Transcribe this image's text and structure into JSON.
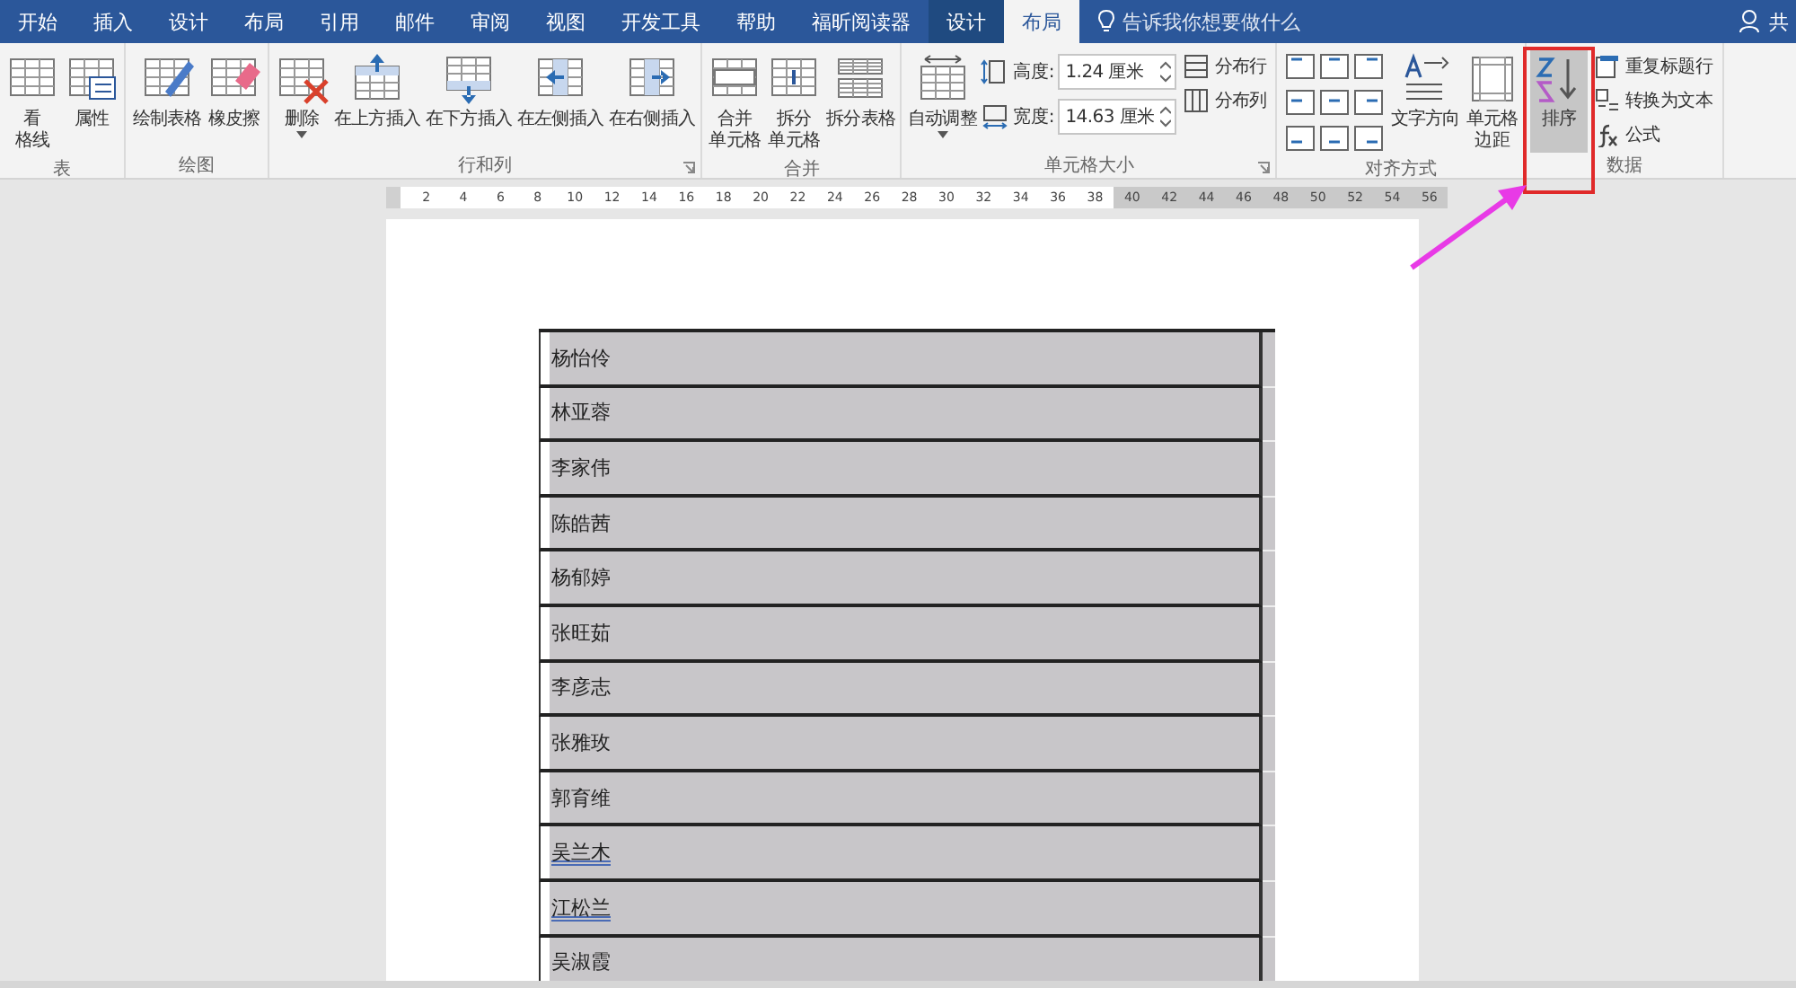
{
  "tabs": [
    {
      "label": "开始",
      "selected": false,
      "kind": "normal"
    },
    {
      "label": "插入",
      "selected": false,
      "kind": "normal"
    },
    {
      "label": "设计",
      "selected": false,
      "kind": "normal"
    },
    {
      "label": "布局",
      "selected": false,
      "kind": "normal"
    },
    {
      "label": "引用",
      "selected": false,
      "kind": "normal"
    },
    {
      "label": "邮件",
      "selected": false,
      "kind": "normal"
    },
    {
      "label": "审阅",
      "selected": false,
      "kind": "normal"
    },
    {
      "label": "视图",
      "selected": false,
      "kind": "normal"
    },
    {
      "label": "开发工具",
      "selected": false,
      "kind": "normal"
    },
    {
      "label": "帮助",
      "selected": false,
      "kind": "normal"
    },
    {
      "label": "福昕阅读器",
      "selected": false,
      "kind": "normal"
    },
    {
      "label": "设计",
      "selected": false,
      "kind": "contextual"
    },
    {
      "label": "布局",
      "selected": true,
      "kind": "contextual"
    }
  ],
  "tell_me": {
    "placeholder": "告诉我你想要做什么"
  },
  "share": {
    "label": "共"
  },
  "ribbon_groups": [
    {
      "label": "表",
      "launcher": false,
      "items": [
        {
          "kind": "large",
          "lines": [
            "看",
            "格线"
          ],
          "dropdown": false,
          "pressed": false
        },
        {
          "kind": "large",
          "lines": [
            "属性"
          ],
          "dropdown": false,
          "pressed": false
        }
      ]
    },
    {
      "label": "绘图",
      "launcher": false,
      "items": [
        {
          "kind": "large",
          "lines": [
            "绘制表格"
          ],
          "dropdown": false,
          "pressed": false
        },
        {
          "kind": "large",
          "lines": [
            "橡皮擦"
          ],
          "dropdown": false,
          "pressed": false
        }
      ]
    },
    {
      "label": "行和列",
      "launcher": true,
      "items": [
        {
          "kind": "large",
          "lines": [
            "删除"
          ],
          "dropdown": true,
          "pressed": false
        },
        {
          "kind": "large",
          "lines": [
            "在上方插入"
          ],
          "dropdown": false,
          "pressed": false
        },
        {
          "kind": "large",
          "lines": [
            "在下方插入"
          ],
          "dropdown": false,
          "pressed": false
        },
        {
          "kind": "large",
          "lines": [
            "在左侧插入"
          ],
          "dropdown": false,
          "pressed": false
        },
        {
          "kind": "large",
          "lines": [
            "在右侧插入"
          ],
          "dropdown": false,
          "pressed": false
        }
      ]
    },
    {
      "label": "合并",
      "launcher": false,
      "items": [
        {
          "kind": "large",
          "lines": [
            "合并",
            "单元格"
          ],
          "dropdown": false,
          "pressed": false
        },
        {
          "kind": "large",
          "lines": [
            "拆分",
            "单元格"
          ],
          "dropdown": false,
          "pressed": false
        },
        {
          "kind": "large",
          "lines": [
            "拆分表格"
          ],
          "dropdown": false,
          "pressed": false
        }
      ]
    },
    {
      "label": "单元格大小",
      "launcher": true,
      "items": [
        {
          "kind": "large",
          "lines": [
            "自动调整"
          ],
          "dropdown": true,
          "pressed": false
        },
        {
          "kind": "stack",
          "items": [
            {
              "kind": "spin",
              "label": "高度:",
              "value": "1.24 厘米"
            },
            {
              "kind": "spin",
              "label": "宽度:",
              "value": "14.63 厘米"
            }
          ]
        },
        {
          "kind": "stack",
          "items": [
            {
              "kind": "small",
              "label": "分布行"
            },
            {
              "kind": "small",
              "label": "分布列"
            }
          ]
        }
      ]
    },
    {
      "label": "对齐方式",
      "launcher": false,
      "items": [
        {
          "kind": "align"
        },
        {
          "kind": "large",
          "lines": [
            "文字方向"
          ],
          "dropdown": false,
          "pressed": false
        },
        {
          "kind": "large",
          "lines": [
            "单元格",
            "边距"
          ],
          "dropdown": false,
          "pressed": false
        }
      ]
    },
    {
      "label": "数据",
      "launcher": false,
      "items": [
        {
          "kind": "large",
          "lines": [
            "排序"
          ],
          "dropdown": false,
          "pressed": true
        },
        {
          "kind": "stack",
          "items": [
            {
              "kind": "small",
              "label": "重复标题行"
            },
            {
              "kind": "small",
              "label": "转换为文本"
            },
            {
              "kind": "small",
              "label": "公式"
            }
          ]
        }
      ]
    }
  ],
  "ruler": [
    {
      "label": "2",
      "shaded": false
    },
    {
      "label": "4",
      "shaded": false
    },
    {
      "label": "6",
      "shaded": false
    },
    {
      "label": "8",
      "shaded": false
    },
    {
      "label": "10",
      "shaded": false
    },
    {
      "label": "12",
      "shaded": false
    },
    {
      "label": "14",
      "shaded": false
    },
    {
      "label": "16",
      "shaded": false
    },
    {
      "label": "18",
      "shaded": false
    },
    {
      "label": "20",
      "shaded": false
    },
    {
      "label": "22",
      "shaded": false
    },
    {
      "label": "24",
      "shaded": false
    },
    {
      "label": "26",
      "shaded": false
    },
    {
      "label": "28",
      "shaded": false
    },
    {
      "label": "30",
      "shaded": false
    },
    {
      "label": "32",
      "shaded": false
    },
    {
      "label": "34",
      "shaded": false
    },
    {
      "label": "36",
      "shaded": false
    },
    {
      "label": "38",
      "shaded": false
    },
    {
      "label": "40",
      "shaded": true
    },
    {
      "label": "42",
      "shaded": true
    },
    {
      "label": "44",
      "shaded": true
    },
    {
      "label": "46",
      "shaded": true
    },
    {
      "label": "48",
      "shaded": true
    },
    {
      "label": "50",
      "shaded": true
    },
    {
      "label": "52",
      "shaded": true
    },
    {
      "label": "54",
      "shaded": true
    },
    {
      "label": "56",
      "shaded": true
    }
  ],
  "table": {
    "rows": [
      {
        "text": "杨怡伶",
        "selected": true,
        "spelling_flag": false
      },
      {
        "text": "林亚蓉",
        "selected": true,
        "spelling_flag": false
      },
      {
        "text": "李家伟",
        "selected": true,
        "spelling_flag": false
      },
      {
        "text": "陈皓茜",
        "selected": true,
        "spelling_flag": false
      },
      {
        "text": "杨郁婷",
        "selected": true,
        "spelling_flag": false
      },
      {
        "text": "张旺茹",
        "selected": true,
        "spelling_flag": false
      },
      {
        "text": "李彦志",
        "selected": true,
        "spelling_flag": false
      },
      {
        "text": "张雅玫",
        "selected": true,
        "spelling_flag": false
      },
      {
        "text": "郭育维",
        "selected": true,
        "spelling_flag": false
      },
      {
        "text": "吴兰木",
        "selected": true,
        "spelling_flag": true
      },
      {
        "text": "江松兰",
        "selected": true,
        "spelling_flag": true
      },
      {
        "text": "吴淑霞",
        "selected": true,
        "spelling_flag": false
      }
    ]
  }
}
